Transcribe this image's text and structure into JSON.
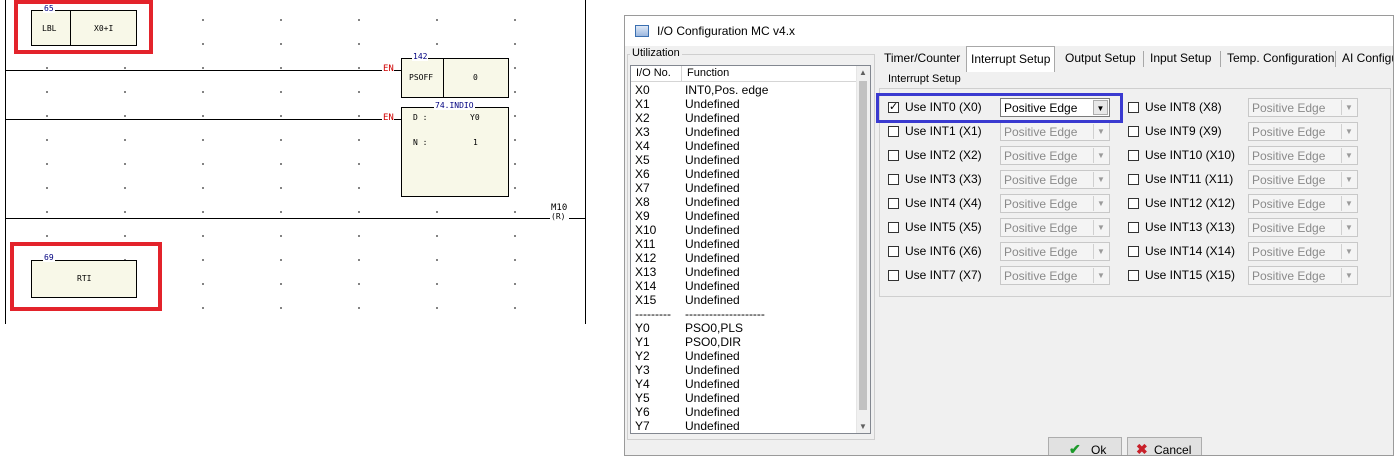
{
  "ladder": {
    "block_65": {
      "num": "65",
      "left": "LBL",
      "right": "X0+I"
    },
    "block_142": {
      "num": "142",
      "label": "PSOFF",
      "value": "0"
    },
    "block_74": {
      "num": "74.INDIO",
      "d_label": "D :",
      "d_value": "Y0",
      "n_label": "N :",
      "n_value": "1"
    },
    "en": "EN",
    "coil": {
      "name": "M10",
      "symbol": "(R)"
    },
    "block_69": {
      "num": "69",
      "label": "RTI"
    },
    "highlight_color": "#e3232b"
  },
  "dialog": {
    "title": "I/O Configuration MC v4.x",
    "utilization": {
      "label": "Utilization",
      "col_io": "I/O No.",
      "col_fn": "Function",
      "rows": [
        {
          "io": "X0",
          "fn": "INT0,Pos. edge"
        },
        {
          "io": "X1",
          "fn": "Undefined"
        },
        {
          "io": "X2",
          "fn": "Undefined"
        },
        {
          "io": "X3",
          "fn": "Undefined"
        },
        {
          "io": "X4",
          "fn": "Undefined"
        },
        {
          "io": "X5",
          "fn": "Undefined"
        },
        {
          "io": "X6",
          "fn": "Undefined"
        },
        {
          "io": "X7",
          "fn": "Undefined"
        },
        {
          "io": "X8",
          "fn": "Undefined"
        },
        {
          "io": "X9",
          "fn": "Undefined"
        },
        {
          "io": "X10",
          "fn": "Undefined"
        },
        {
          "io": "X11",
          "fn": "Undefined"
        },
        {
          "io": "X12",
          "fn": "Undefined"
        },
        {
          "io": "X13",
          "fn": "Undefined"
        },
        {
          "io": "X14",
          "fn": "Undefined"
        },
        {
          "io": "X15",
          "fn": "Undefined"
        },
        {
          "io": "---------",
          "fn": "--------------------"
        },
        {
          "io": "Y0",
          "fn": "PSO0,PLS"
        },
        {
          "io": "Y1",
          "fn": "PSO0,DIR"
        },
        {
          "io": "Y2",
          "fn": "Undefined"
        },
        {
          "io": "Y3",
          "fn": "Undefined"
        },
        {
          "io": "Y4",
          "fn": "Undefined"
        },
        {
          "io": "Y5",
          "fn": "Undefined"
        },
        {
          "io": "Y6",
          "fn": "Undefined"
        },
        {
          "io": "Y7",
          "fn": "Undefined"
        }
      ]
    },
    "tabs": [
      "Timer/Counter",
      "Interrupt Setup",
      "Output Setup",
      "Input Setup",
      "Temp. Configuration",
      "AI Configu"
    ],
    "active_tab": "Interrupt Setup",
    "interrupt": {
      "group_label": "Interrupt Setup",
      "left": [
        {
          "label": "Use INT0 (X0)",
          "checked": true,
          "edge": "Positive Edge"
        },
        {
          "label": "Use INT1 (X1)",
          "checked": false,
          "edge": "Positive Edge"
        },
        {
          "label": "Use INT2 (X2)",
          "checked": false,
          "edge": "Positive Edge"
        },
        {
          "label": "Use INT3 (X3)",
          "checked": false,
          "edge": "Positive Edge"
        },
        {
          "label": "Use INT4 (X4)",
          "checked": false,
          "edge": "Positive Edge"
        },
        {
          "label": "Use INT5 (X5)",
          "checked": false,
          "edge": "Positive Edge"
        },
        {
          "label": "Use INT6 (X6)",
          "checked": false,
          "edge": "Positive Edge"
        },
        {
          "label": "Use INT7 (X7)",
          "checked": false,
          "edge": "Positive Edge"
        }
      ],
      "right": [
        {
          "label": "Use INT8 (X8)",
          "checked": false,
          "edge": "Positive Edge"
        },
        {
          "label": "Use INT9 (X9)",
          "checked": false,
          "edge": "Positive Edge"
        },
        {
          "label": "Use INT10 (X10)",
          "checked": false,
          "edge": "Positive Edge"
        },
        {
          "label": "Use INT11 (X11)",
          "checked": false,
          "edge": "Positive Edge"
        },
        {
          "label": "Use INT12 (X12)",
          "checked": false,
          "edge": "Positive Edge"
        },
        {
          "label": "Use INT13 (X13)",
          "checked": false,
          "edge": "Positive Edge"
        },
        {
          "label": "Use INT14 (X14)",
          "checked": false,
          "edge": "Positive Edge"
        },
        {
          "label": "Use INT15 (X15)",
          "checked": false,
          "edge": "Positive Edge"
        }
      ],
      "focus_color": "#3a3ad0"
    },
    "buttons": {
      "ok": "Ok",
      "cancel": "Cancel"
    }
  }
}
